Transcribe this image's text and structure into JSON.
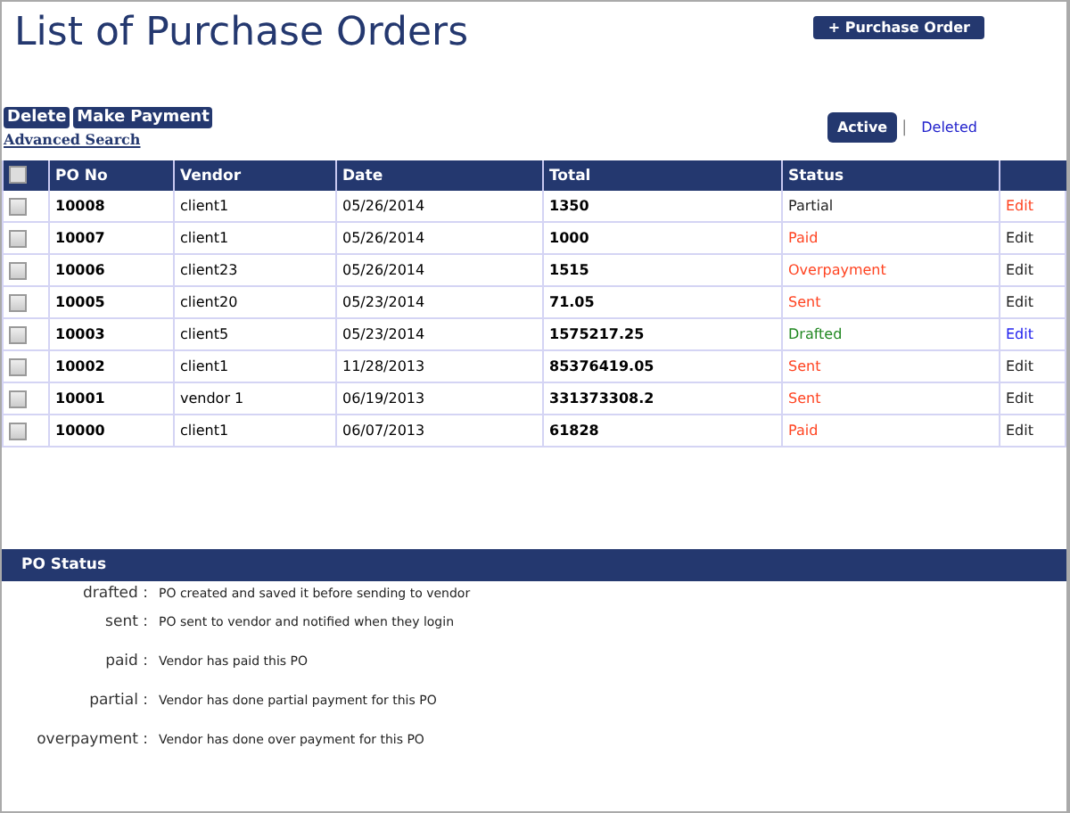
{
  "title": "List of Purchase Orders",
  "new_button": "+ Purchase Order",
  "actions": [
    "Delete",
    "Make Payment"
  ],
  "advanced_search": "Advanced Search",
  "filter_separator": "|",
  "filters": [
    {
      "label": "Active",
      "selected": true
    },
    {
      "label": "Deleted",
      "selected": false
    }
  ],
  "table": {
    "select_all_checked": false,
    "columns": [
      "PO No",
      "Vendor",
      "Date",
      "Total",
      "Status"
    ],
    "rows": [
      {
        "checked": false,
        "po_no": "10008",
        "vendor": "client1",
        "date": "05/26/2014",
        "total": "1350",
        "status": {
          "text": "Partial",
          "color": "#222222"
        },
        "edit": {
          "text": "Edit",
          "color": "#ff4422"
        }
      },
      {
        "checked": false,
        "po_no": "10007",
        "vendor": "client1",
        "date": "05/26/2014",
        "total": "1000",
        "status": {
          "text": "Paid",
          "color": "#ff4422"
        },
        "edit": {
          "text": "Edit",
          "color": "#222222"
        }
      },
      {
        "checked": false,
        "po_no": "10006",
        "vendor": "client23",
        "date": "05/26/2014",
        "total": "1515",
        "status": {
          "text": "Overpayment",
          "color": "#ff4422"
        },
        "edit": {
          "text": "Edit",
          "color": "#222222"
        }
      },
      {
        "checked": false,
        "po_no": "10005",
        "vendor": "client20",
        "date": "05/23/2014",
        "total": "71.05",
        "status": {
          "text": "Sent",
          "color": "#ff4422"
        },
        "edit": {
          "text": "Edit",
          "color": "#222222"
        }
      },
      {
        "checked": false,
        "po_no": "10003",
        "vendor": "client5",
        "date": "05/23/2014",
        "total": "1575217.25",
        "status": {
          "text": "Drafted",
          "color": "#228822"
        },
        "edit": {
          "text": "Edit",
          "color": "#2222ee"
        }
      },
      {
        "checked": false,
        "po_no": "10002",
        "vendor": "client1",
        "date": "11/28/2013",
        "total": "85376419.05",
        "status": {
          "text": "Sent",
          "color": "#ff4422"
        },
        "edit": {
          "text": "Edit",
          "color": "#222222"
        }
      },
      {
        "checked": false,
        "po_no": "10001",
        "vendor": "vendor 1",
        "date": "06/19/2013",
        "total": "331373308.2",
        "status": {
          "text": "Sent",
          "color": "#ff4422"
        },
        "edit": {
          "text": "Edit",
          "color": "#222222"
        }
      },
      {
        "checked": false,
        "po_no": "10000",
        "vendor": "client1",
        "date": "06/07/2013",
        "total": "61828",
        "status": {
          "text": "Paid",
          "color": "#ff4422"
        },
        "edit": {
          "text": "Edit",
          "color": "#222222"
        }
      }
    ]
  },
  "legend": {
    "title": "PO Status",
    "items": [
      {
        "term": "drafted :",
        "description": "PO created and saved it before sending to vendor"
      },
      {
        "term": "sent :",
        "description": "PO sent to vendor and notified when they login"
      },
      {
        "term": "paid :",
        "description": "Vendor has paid this PO"
      },
      {
        "term": "partial :",
        "description": "Vendor has done partial payment for this PO"
      },
      {
        "term": "overpayment :",
        "description": "Vendor has done over payment for this PO"
      }
    ]
  }
}
